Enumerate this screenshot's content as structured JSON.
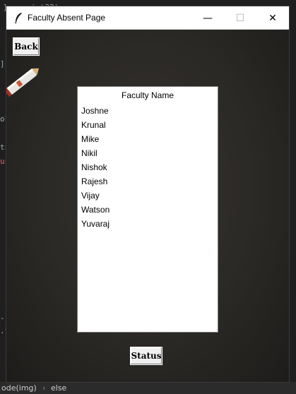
{
  "background_editor": {
    "code_top": "np.int32)",
    "bottom_left": "ode(img)",
    "bottom_keyword": "else"
  },
  "window": {
    "title": "Faculty Absent Page",
    "controls": {
      "minimize": "—",
      "maximize": "☐",
      "close": "✕"
    }
  },
  "toolbar": {
    "back_label": "Back"
  },
  "faculty_list": {
    "header": "Faculty Name",
    "items": [
      "Joshne",
      "Krunal",
      "Mike",
      "Nikil",
      "Nishok",
      "Rajesh",
      "Vijay",
      "Watson",
      "Yuvaraj"
    ]
  },
  "footer": {
    "status_label": "Status"
  }
}
